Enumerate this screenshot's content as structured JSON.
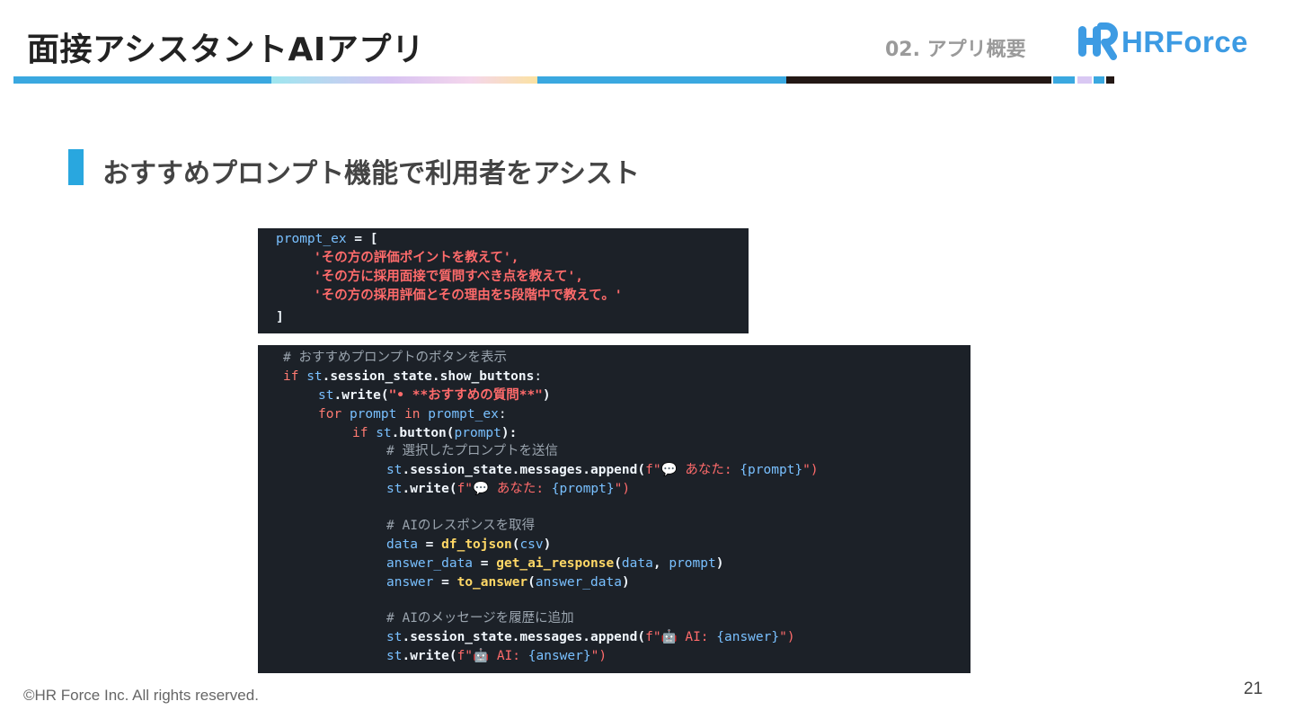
{
  "header": {
    "title": "面接アシスタントAIアプリ",
    "section": "02. アプリ概要",
    "logo_text": "HRForce"
  },
  "colors": {
    "accent_blue": "#29a7df",
    "code_bg": "#1c2128",
    "bar_dark": "#231815"
  },
  "subtitle": "おすすめプロンプト機能で利用者をアシスト",
  "code1": {
    "line1_var": "prompt_ex",
    "line1_op": " = [",
    "line2": "'その方の評価ポイントを教えて',",
    "line3": "'その方に採用面接で質問すべき点を教えて',",
    "line4": "'その方の採用評価とその理由を5段階中で教えて。'",
    "line5": "]"
  },
  "code2": {
    "l1": "# おすすめプロンプトのボタンを表示",
    "l2_kw": "if",
    "l2_a": "st",
    "l2_b": ".session_state.show_buttons",
    "l2_c": ":",
    "l3_a": "st",
    "l3_b": ".write(",
    "l3_str": "\"• **おすすめの質問**\"",
    "l3_c": ")",
    "l4_kw": "for",
    "l4_a": "prompt",
    "l4_in": "in",
    "l4_b": "prompt_ex",
    "l4_c": ":",
    "l5_kw": "if",
    "l5_a": "st",
    "l5_b": ".button(",
    "l5_c": "prompt",
    "l5_d": "):",
    "l6": "# 選択したプロンプトを送信",
    "l7_a": "st",
    "l7_b": ".session_state.messages.append(",
    "l7_str": "f\"💬 あなた: ",
    "l7_var": "{prompt}",
    "l7_end": "\")",
    "l8_a": "st",
    "l8_b": ".write(",
    "l8_str": "f\"💬 あなた: ",
    "l8_var": "{prompt}",
    "l8_end": "\")",
    "l9": "# AIのレスポンスを取得",
    "l10_a": "data",
    "l10_b": " = ",
    "l10_fn": "df_tojson",
    "l10_c": "(",
    "l10_d": "csv",
    "l10_e": ")",
    "l11_a": "answer_data",
    "l11_b": " = ",
    "l11_fn": "get_ai_response",
    "l11_c": "(",
    "l11_d": "data",
    "l11_e": ", ",
    "l11_f": "prompt",
    "l11_g": ")",
    "l12_a": "answer",
    "l12_b": " = ",
    "l12_fn": "to_answer",
    "l12_c": "(",
    "l12_d": "answer_data",
    "l12_e": ")",
    "l13": "# AIのメッセージを履歴に追加",
    "l14_a": "st",
    "l14_b": ".session_state.messages.append(",
    "l14_str": "f\"🤖 AI: ",
    "l14_var": "{answer}",
    "l14_end": "\")",
    "l15_a": "st",
    "l15_b": ".write(",
    "l15_str": "f\"🤖 AI: ",
    "l15_var": "{answer}",
    "l15_end": "\")"
  },
  "footer": "©HR Force Inc. All rights reserved.",
  "page_number": "21"
}
